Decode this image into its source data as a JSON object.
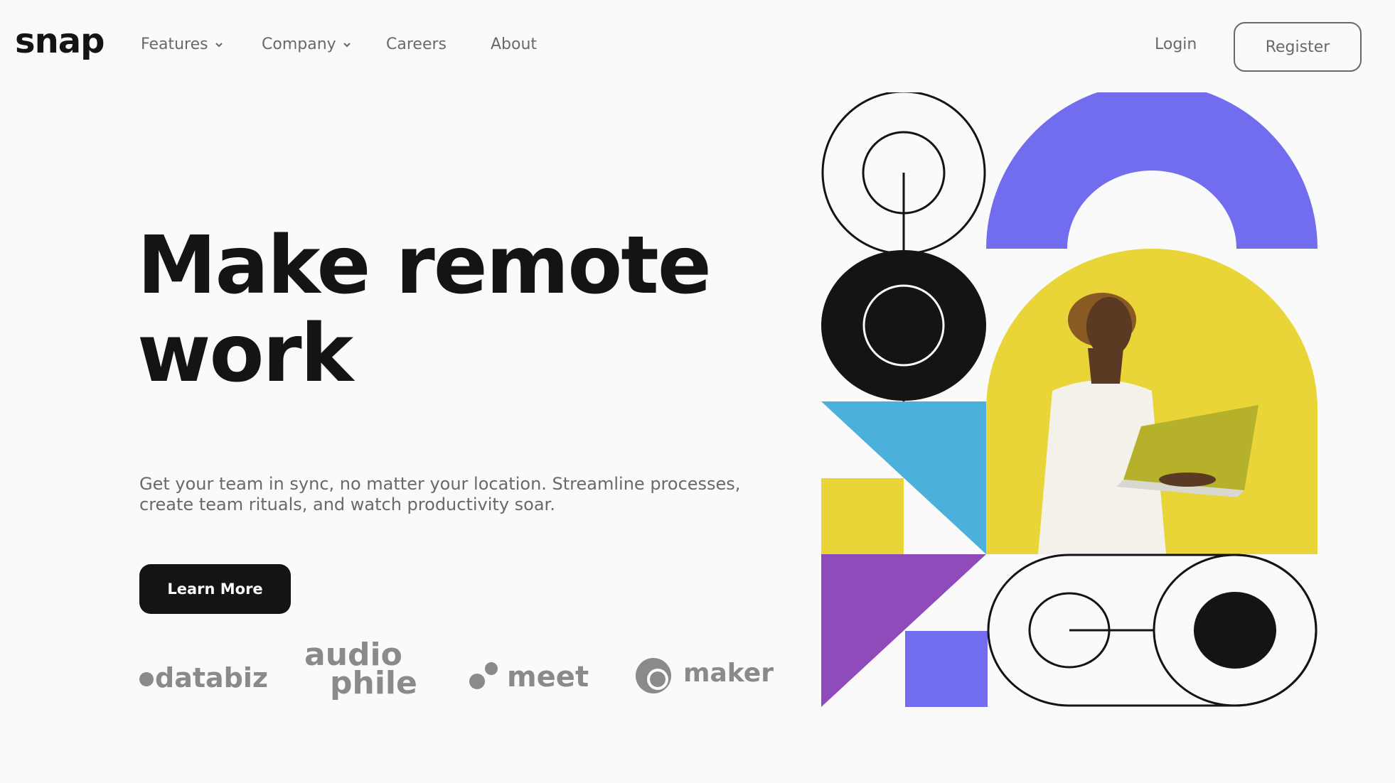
{
  "header": {
    "logo": "snap",
    "nav": [
      {
        "label": "Features",
        "has_dropdown": true
      },
      {
        "label": "Company",
        "has_dropdown": true
      },
      {
        "label": "Careers",
        "has_dropdown": false
      },
      {
        "label": "About",
        "has_dropdown": false
      }
    ],
    "login_label": "Login",
    "register_label": "Register"
  },
  "hero": {
    "headline_line1": "Make remote",
    "headline_line2": "work",
    "subtext": "Get your team in sync, no matter your location. Streamline processes, create team rituals, and watch productivity soar.",
    "cta_label": "Learn More"
  },
  "clients": {
    "databiz": "databiz",
    "audiophile_line1": "audio",
    "audiophile_line2": "phile",
    "meet": "meet",
    "maker": "maker"
  },
  "colors": {
    "ink": "#141414",
    "gray": "#696969",
    "purple_blue": "#726cee",
    "yellow": "#e9d538",
    "cyan": "#4bb1da",
    "violet": "#8f4bb9"
  }
}
